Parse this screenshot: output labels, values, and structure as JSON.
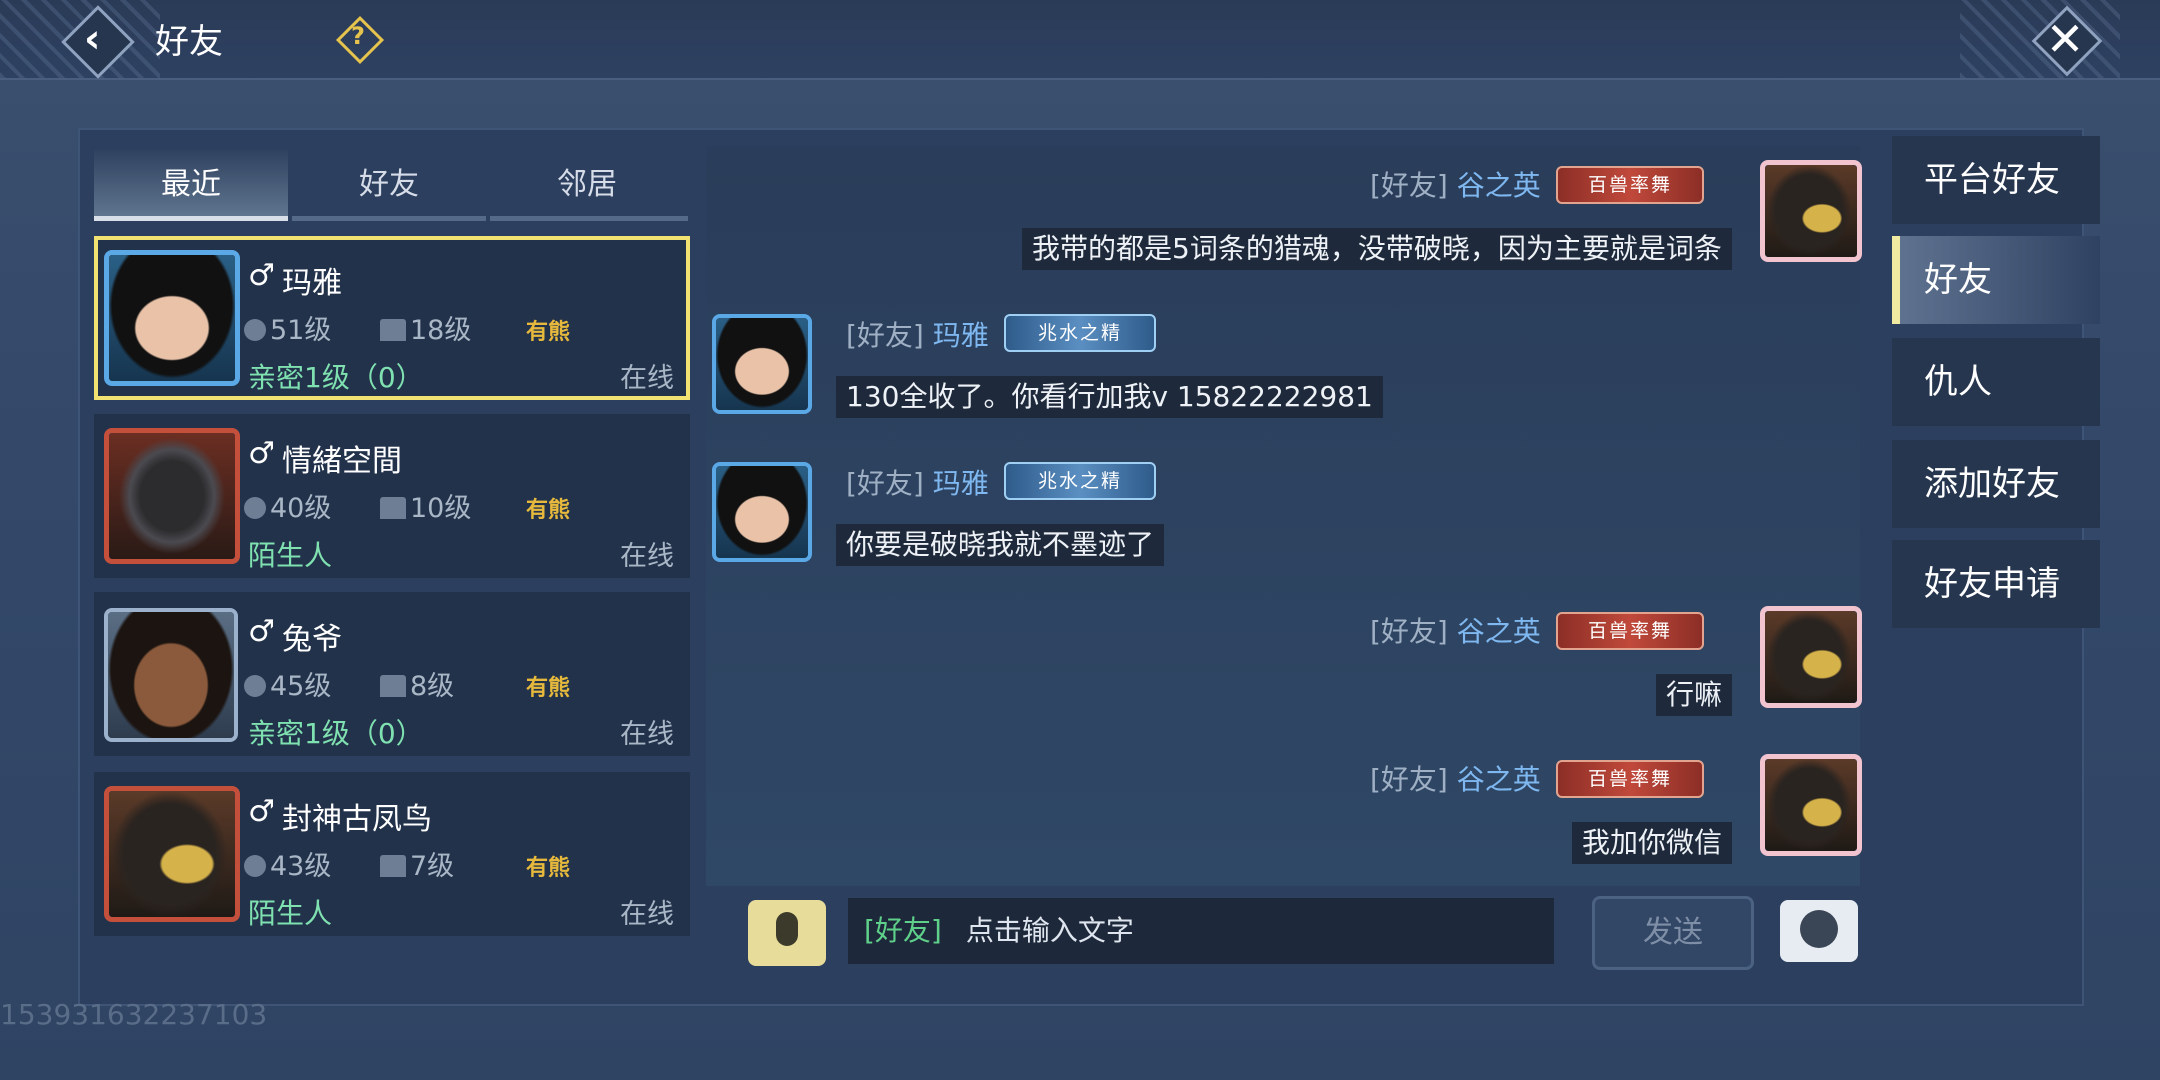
{
  "header": {
    "title": "好友",
    "help_label": "?"
  },
  "tabs": [
    {
      "label": "最近"
    },
    {
      "label": "好友"
    },
    {
      "label": "邻居"
    }
  ],
  "friends": [
    {
      "name": "玛雅",
      "gender": "♂",
      "level": "51级",
      "house_level": "18级",
      "tag": "有熊",
      "relation": "亲密1级（0）",
      "status": "在线"
    },
    {
      "name": "情緒空間",
      "gender": "♂",
      "level": "40级",
      "house_level": "10级",
      "tag": "有熊",
      "relation": "陌生人",
      "status": "在线"
    },
    {
      "name": "兔爷",
      "gender": "♂",
      "level": "45级",
      "house_level": "8级",
      "tag": "有熊",
      "relation": "亲密1级（0）",
      "status": "在线"
    },
    {
      "name": "封神古凤鸟",
      "gender": "♂",
      "level": "43级",
      "house_level": "7级",
      "tag": "有熊",
      "relation": "陌生人",
      "status": "在线"
    }
  ],
  "messages": [
    {
      "channel": "[好友]",
      "sender": "谷之英",
      "badge": "百兽率舞",
      "text": "我带的都是5词条的猎魂，没带破晓，因为主要就是词条"
    },
    {
      "channel": "[好友]",
      "sender": "玛雅",
      "badge": "兆水之精",
      "text": "130全收了。你看行加我v 15822222981"
    },
    {
      "channel": "[好友]",
      "sender": "玛雅",
      "badge": "兆水之精",
      "text": "你要是破晓我就不墨迹了"
    },
    {
      "channel": "[好友]",
      "sender": "谷之英",
      "badge": "百兽率舞",
      "text": "行嘛"
    },
    {
      "channel": "[好友]",
      "sender": "谷之英",
      "badge": "百兽率舞",
      "text": "我加你微信"
    }
  ],
  "input": {
    "channel": "[好友]",
    "placeholder": "点击输入文字",
    "send_label": "发送"
  },
  "side_menu": [
    {
      "label": "平台好友"
    },
    {
      "label": "好友"
    },
    {
      "label": "仇人"
    },
    {
      "label": "添加好友"
    },
    {
      "label": "好友申请"
    }
  ],
  "watermark": "153931632237103",
  "icons": [
    "back-icon",
    "help-icon",
    "close-icon",
    "microphone-icon",
    "emoji-icon",
    "level-icon",
    "house-icon"
  ]
}
